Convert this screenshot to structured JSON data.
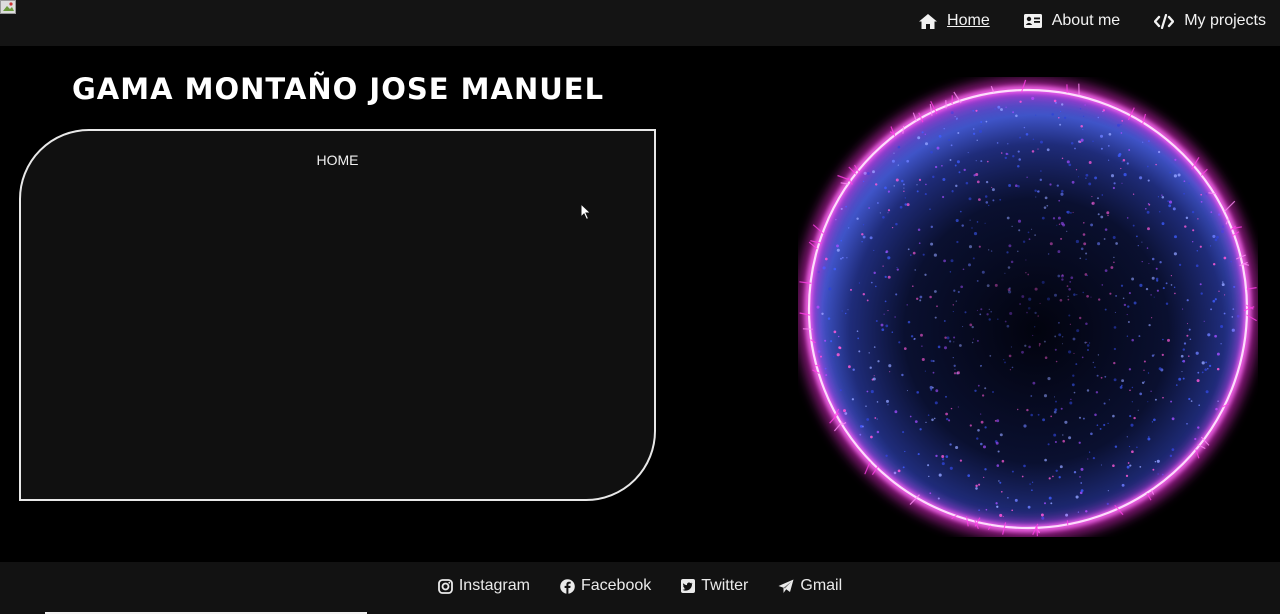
{
  "nav": {
    "items": [
      {
        "label": "Home",
        "icon": "home-icon",
        "active": true
      },
      {
        "label": "About me",
        "icon": "id-card-icon",
        "active": false
      },
      {
        "label": "My projects",
        "icon": "code-icon",
        "active": false
      }
    ]
  },
  "main": {
    "title": "GAMA MONTAÑO JOSE MANUEL",
    "panel_title": "HOME"
  },
  "footer": {
    "links": [
      {
        "label": "Instagram",
        "icon": "instagram-icon"
      },
      {
        "label": "Facebook",
        "icon": "facebook-icon"
      },
      {
        "label": "Twitter",
        "icon": "twitter-icon"
      },
      {
        "label": "Gmail",
        "icon": "paper-plane-icon"
      }
    ]
  },
  "colors": {
    "background": "#000000",
    "bar": "#141414",
    "panel": "#101010",
    "orb_glow": "#ff4dff",
    "orb_particles": "#4a6bff"
  }
}
